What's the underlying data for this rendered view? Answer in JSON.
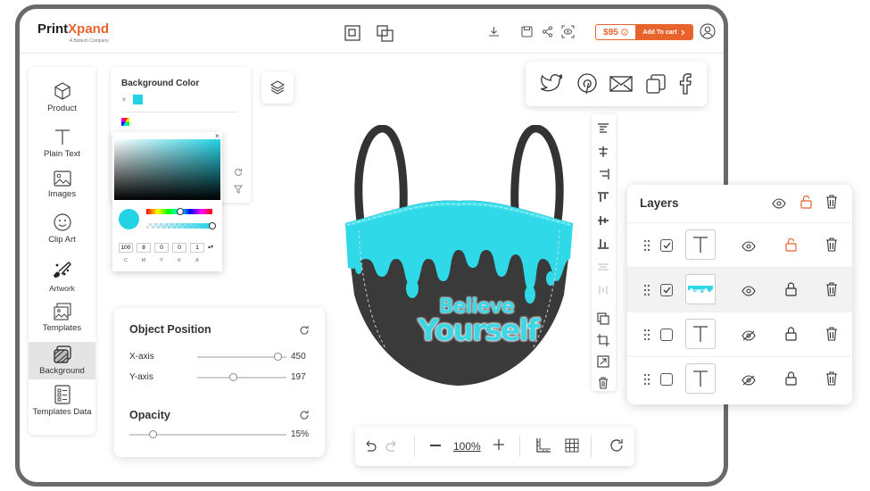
{
  "brand": {
    "name_part1": "Print",
    "name_part2": "Xpand",
    "tagline": "A Biztech Company"
  },
  "header": {
    "price": "$95",
    "add_to_cart": "Add To cart"
  },
  "sidebar": {
    "items": [
      {
        "label": "Product",
        "icon": "cube-icon"
      },
      {
        "label": "Plain Text",
        "icon": "text-icon"
      },
      {
        "label": "Images",
        "icon": "image-icon"
      },
      {
        "label": "Clip Art",
        "icon": "smiley-icon"
      },
      {
        "label": "Artwork",
        "icon": "palette-icon"
      },
      {
        "label": "Templates",
        "icon": "templates-icon"
      },
      {
        "label": "Background",
        "icon": "background-icon",
        "active": true
      },
      {
        "label": "Templates Data",
        "icon": "templates-data-icon"
      }
    ]
  },
  "background_panel": {
    "title": "Background Color",
    "selected_color": "#22d3e6"
  },
  "color_picker": {
    "hue_color": "#22d3e6",
    "cmyk_values": [
      "100",
      "8",
      "0",
      "0",
      "1"
    ],
    "cmyk_labels": [
      "C",
      "M",
      "Y",
      "K",
      "A"
    ],
    "hue_level": 0.52,
    "alpha_level": 1.0
  },
  "object_position": {
    "title": "Object Position",
    "x_label": "X-axis",
    "x_value": "450",
    "x_level": 0.9,
    "y_label": "Y-axis",
    "y_value": "197",
    "y_level": 0.4,
    "opacity_title": "Opacity",
    "opacity_value": "15%",
    "opacity_level": 0.15
  },
  "canvas": {
    "text_line1": "Believe",
    "text_line2": "Yourself",
    "mask_color": "#3a3a3a",
    "accent": "#22d3e6"
  },
  "zoom": {
    "value": "100%"
  },
  "share": {
    "items": [
      "twitter-icon",
      "pinterest-icon",
      "email-icon",
      "copy-icon",
      "facebook-icon"
    ]
  },
  "layers": {
    "title": "Layers",
    "rows": [
      {
        "checked": true,
        "thumb": "text",
        "visible": true,
        "locked": false,
        "selected": false
      },
      {
        "checked": true,
        "thumb": "image",
        "visible": true,
        "locked": true,
        "selected": true
      },
      {
        "checked": false,
        "thumb": "text",
        "visible": false,
        "locked": true,
        "selected": false
      },
      {
        "checked": false,
        "thumb": "text",
        "visible": false,
        "locked": true,
        "selected": false
      }
    ]
  },
  "colors": {
    "accent": "#e8622c",
    "cyan": "#22d3e6"
  }
}
